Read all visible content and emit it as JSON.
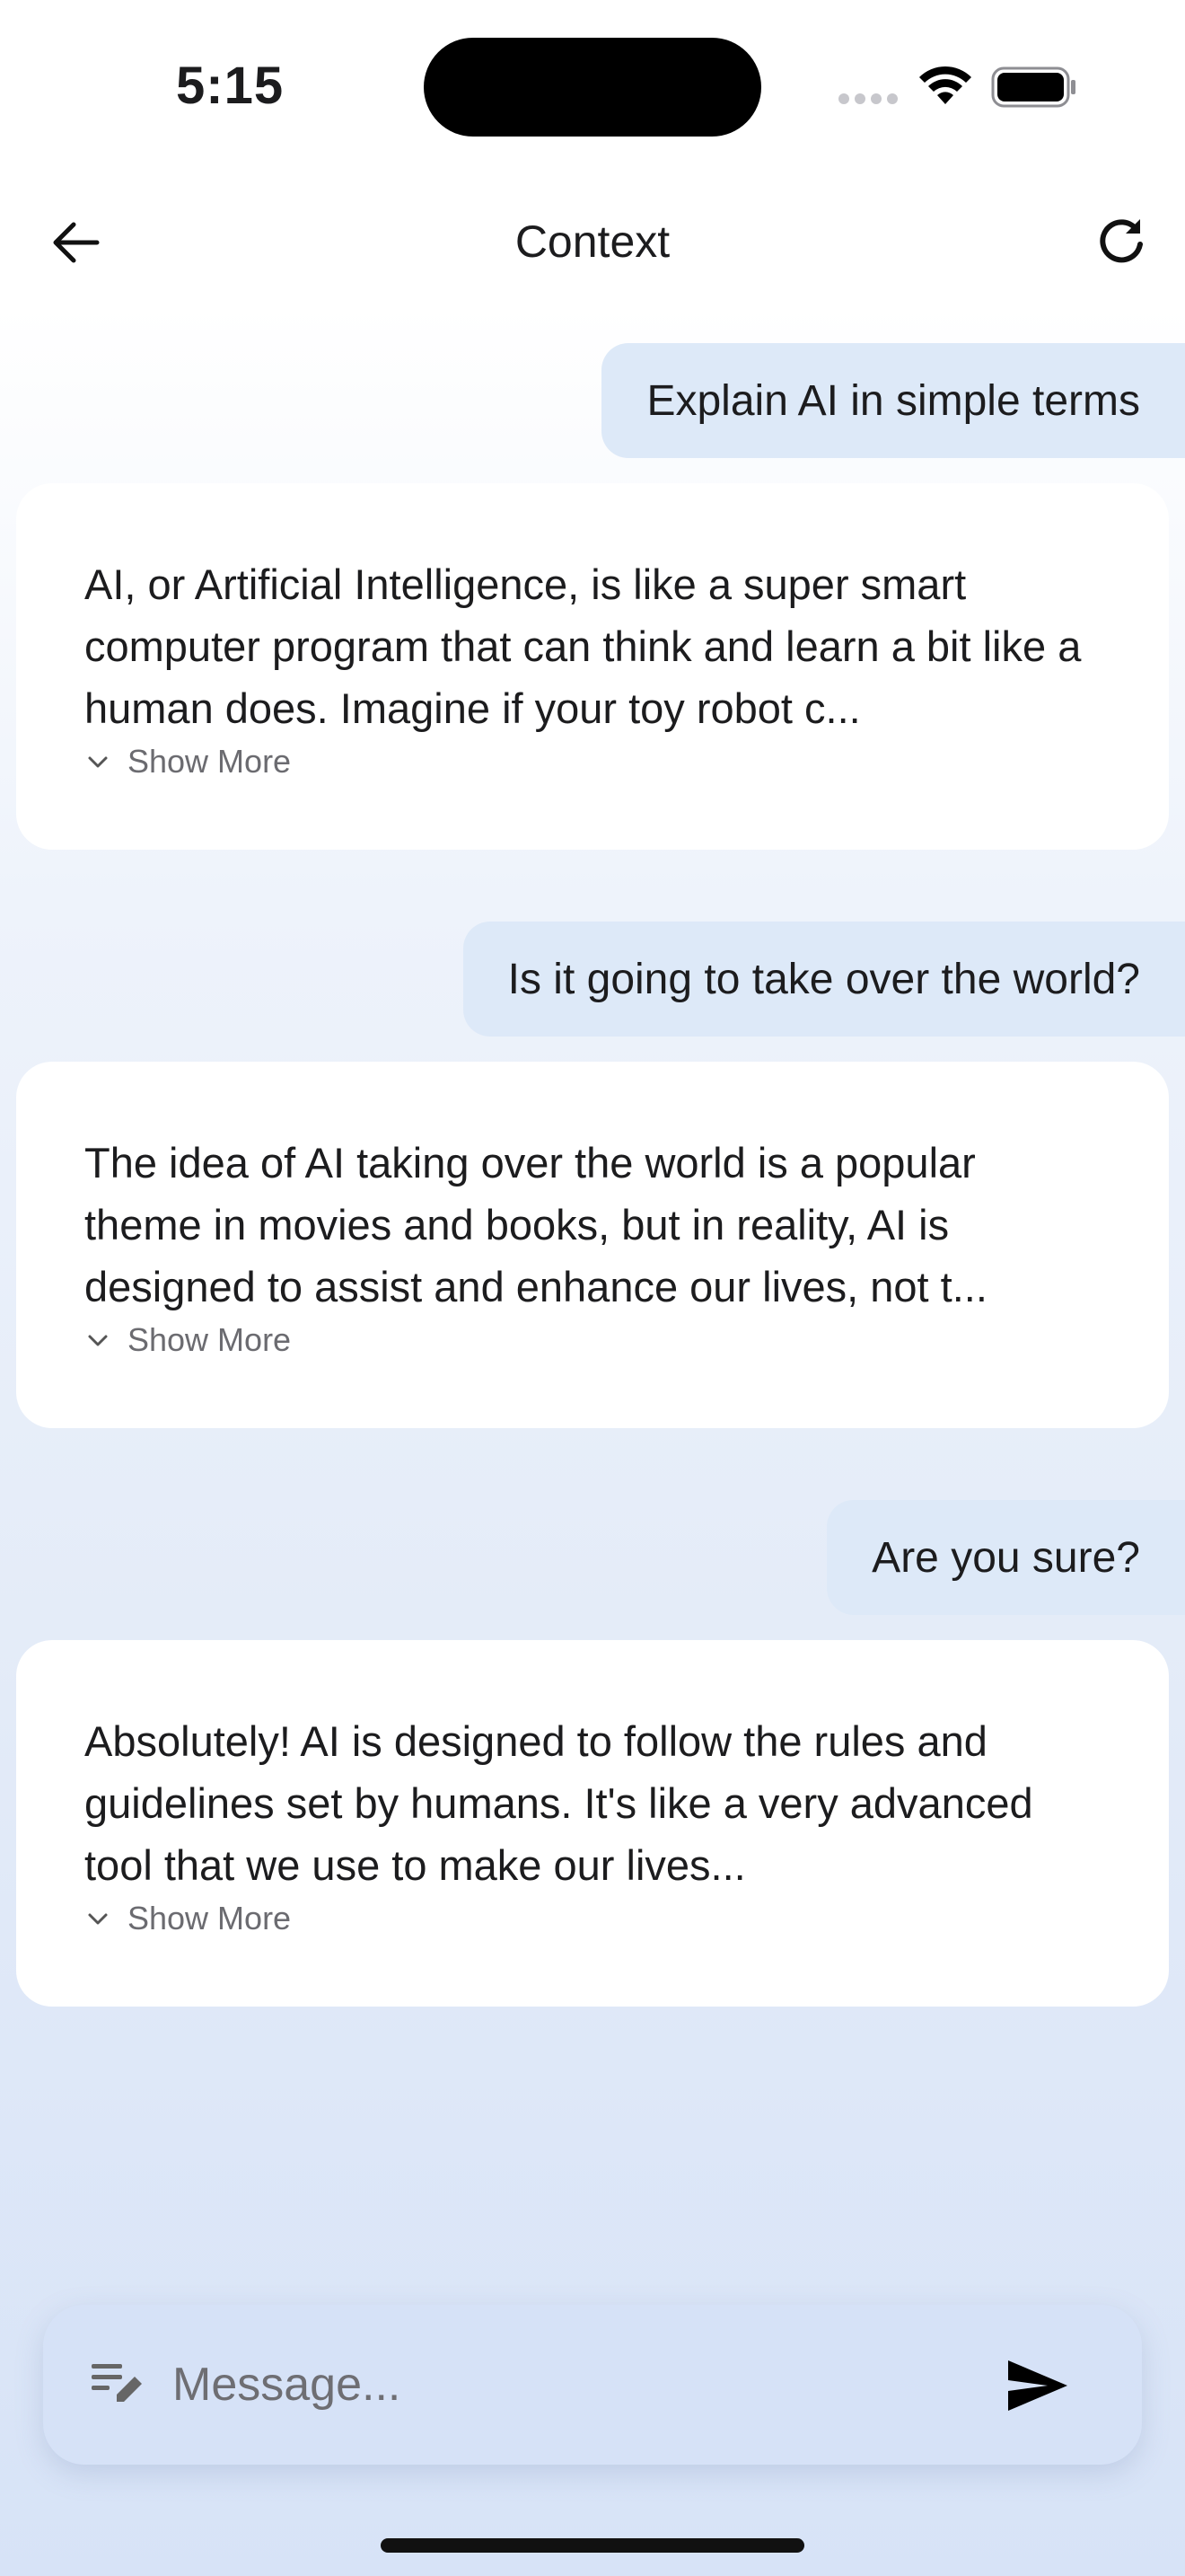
{
  "status_bar": {
    "time": "5:15",
    "icons": [
      "cellular-signal-icon",
      "wifi-icon",
      "battery-icon"
    ]
  },
  "nav": {
    "title": "Context",
    "back_icon": "arrow-left-icon",
    "refresh_icon": "refresh-icon"
  },
  "messages": [
    {
      "role": "user",
      "text": "Explain AI in simple terms"
    },
    {
      "role": "assistant",
      "text": "AI, or Artificial Intelligence, is like a super smart computer program that can think and learn a bit like a human does. Imagine if your toy robot c...",
      "show_more": "Show More"
    },
    {
      "role": "user",
      "text": "Is it going to take over the world?"
    },
    {
      "role": "assistant",
      "text": "The idea of AI taking over the world is a popular theme in movies and books, but in reality, AI is designed to assist and enhance our lives, not t...",
      "show_more": "Show More"
    },
    {
      "role": "user",
      "text": "Are you sure?"
    },
    {
      "role": "assistant",
      "text": "Absolutely! AI is designed to follow the rules and guidelines set by humans. It's like a very advanced tool that we use to make our lives...",
      "show_more": "Show More"
    }
  ],
  "composer": {
    "placeholder": "Message...",
    "value": "",
    "left_icon": "edit-note-icon",
    "send_icon": "send-icon"
  },
  "colors": {
    "user_bubble": "#dde9f8",
    "card": "#ffffff",
    "composer": "#d6e2f7",
    "muted_text": "#6b6b70"
  }
}
